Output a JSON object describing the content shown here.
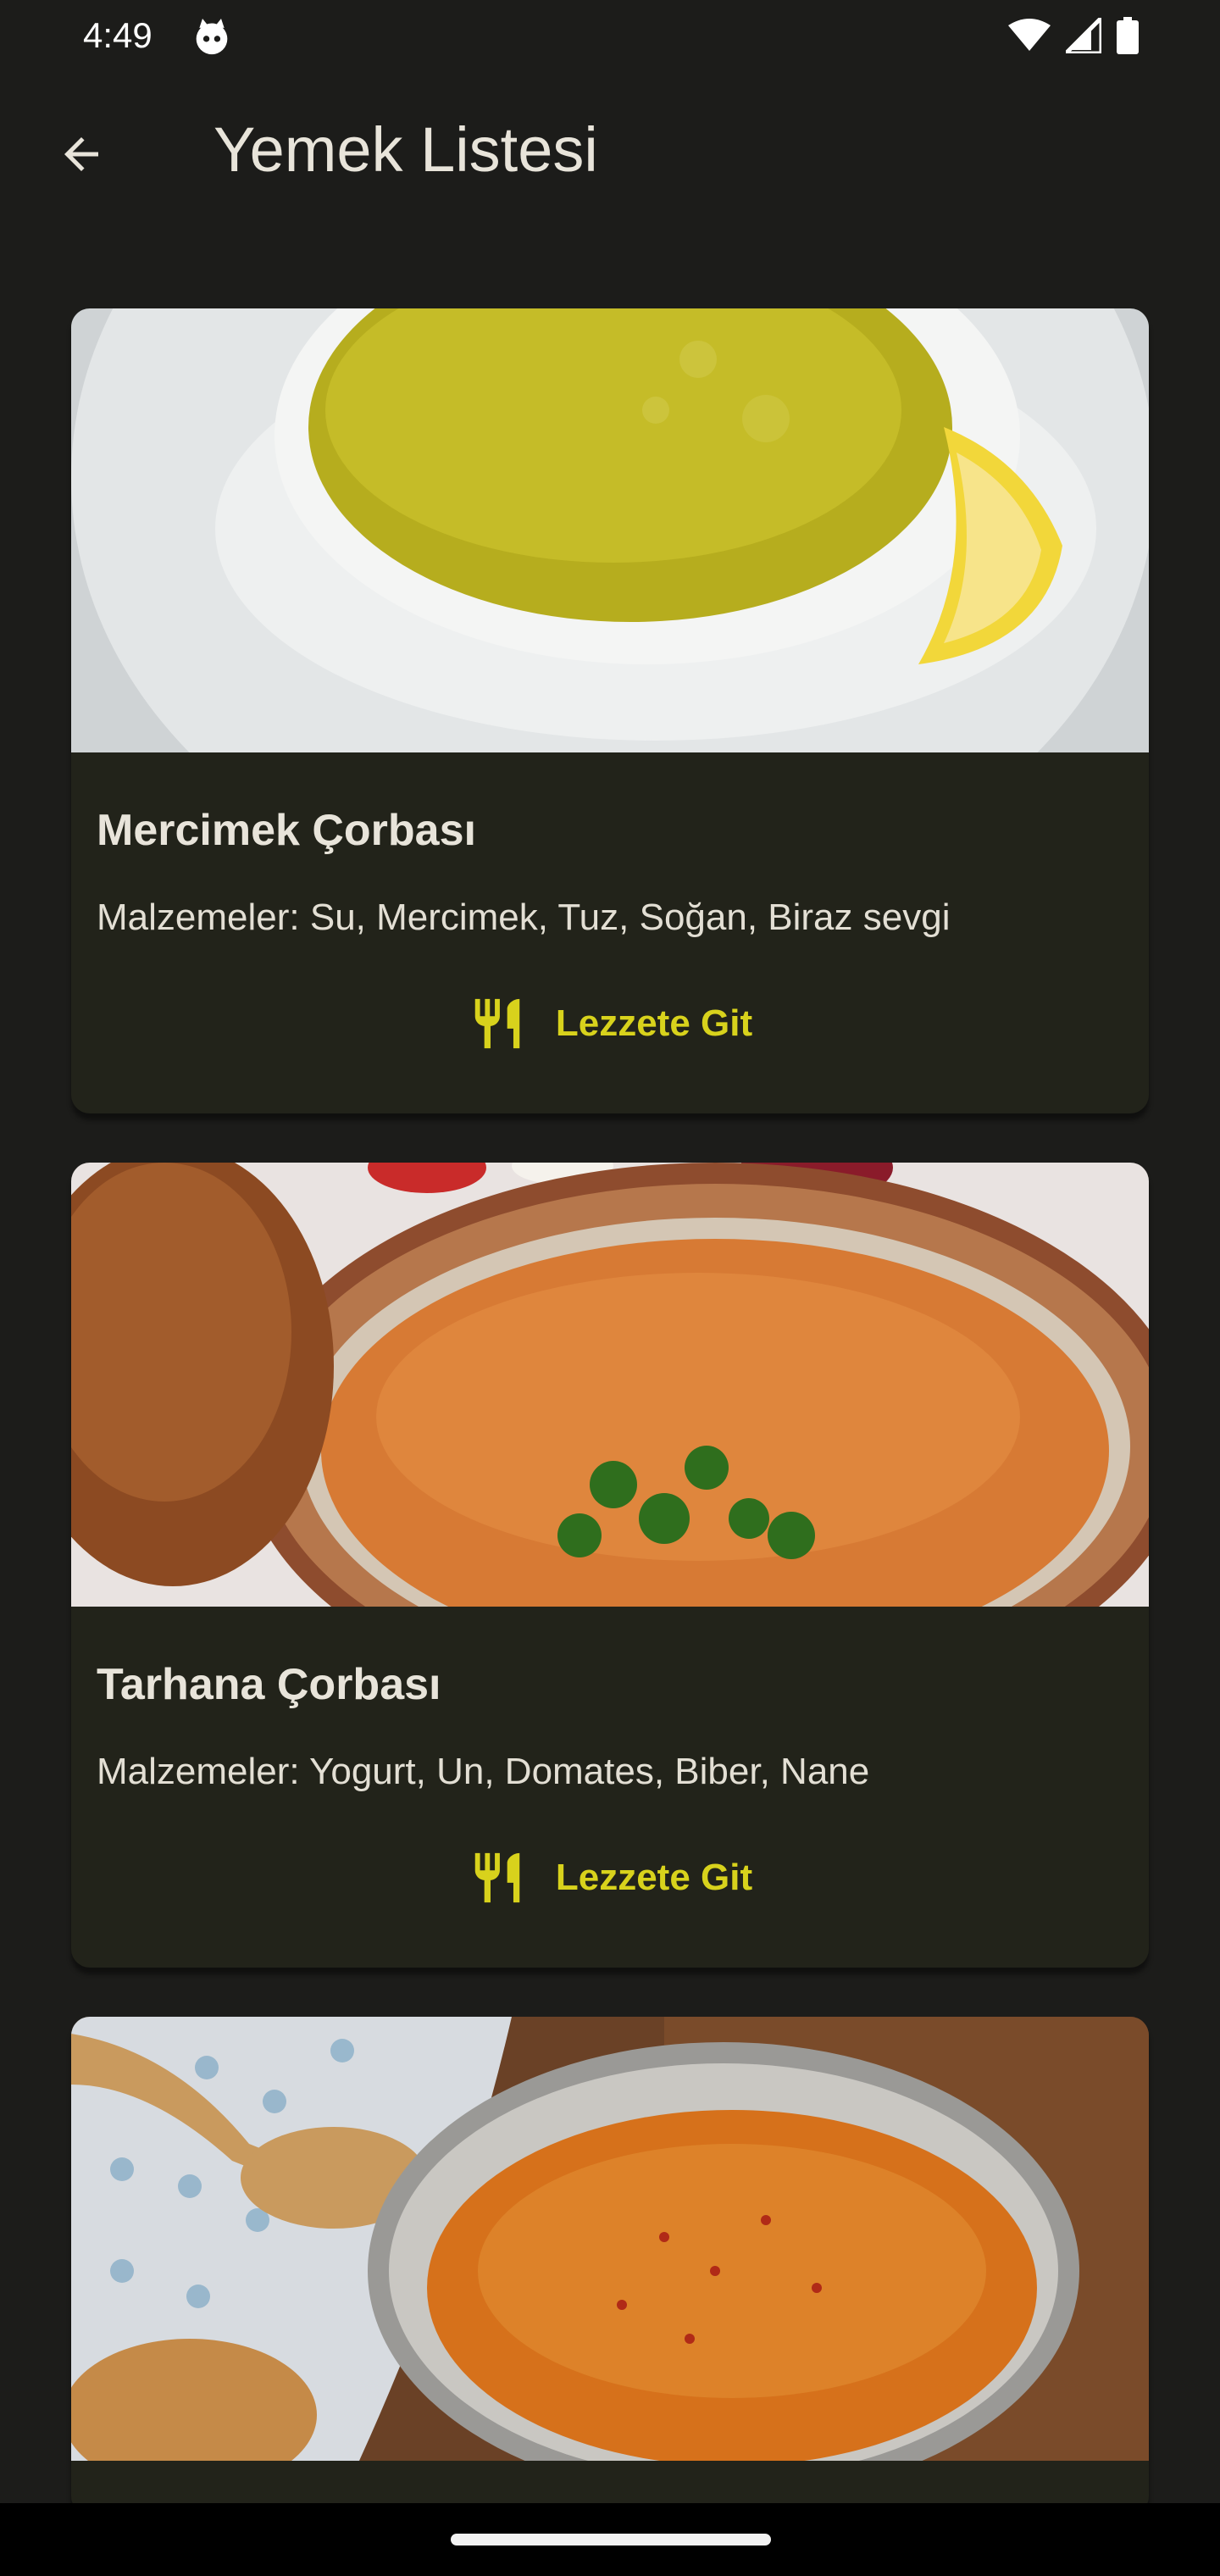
{
  "status_bar": {
    "time": "4:49"
  },
  "app_bar": {
    "title": "Yemek Listesi",
    "back_icon": "arrow-back-icon"
  },
  "recipes": [
    {
      "title": "Mercimek Çorbası",
      "ingredients": "Malzemeler: Su, Mercimek, Tuz, Soğan, Biraz sevgi",
      "action_label": "Lezzete Git",
      "action_icon": "restaurant-icon"
    },
    {
      "title": "Tarhana Çorbası",
      "ingredients": "Malzemeler: Yogurt, Un, Domates, Biber, Nane",
      "action_label": "Lezzete Git",
      "action_icon": "restaurant-icon"
    }
  ],
  "colors": {
    "background": "#1c1c1a",
    "card": "#22231a",
    "accent": "#d8d21c"
  }
}
